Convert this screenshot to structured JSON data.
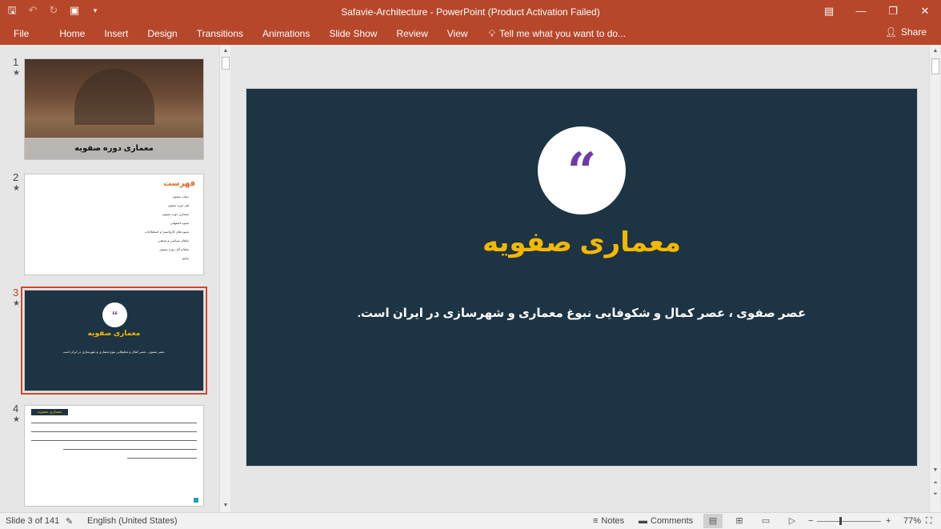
{
  "window": {
    "title": "Safavie-Architecture - PowerPoint (Product Activation Failed)",
    "qat_icons": [
      "save-icon",
      "undo-icon",
      "redo-icon",
      "present-icon",
      "customize-icon"
    ],
    "controls": [
      "ribbon-display-icon",
      "minimize-icon",
      "restore-icon",
      "close-icon"
    ]
  },
  "ribbon": {
    "tabs": [
      "File",
      "Home",
      "Insert",
      "Design",
      "Transitions",
      "Animations",
      "Slide Show",
      "Review",
      "View"
    ],
    "tell_me": "Tell me what you want to do...",
    "share": "Share"
  },
  "thumbnails": [
    {
      "num": "1",
      "title": "معماری دوره صفویه"
    },
    {
      "num": "2",
      "heading": "فهرست",
      "items": [
        "دولت صفوی",
        "هنر دوره صفوی",
        "معماری دوره صفوی",
        "شیوه اصفهانی",
        "شیوه های کاروانسرا و اصطلاحات",
        "بناهای سیاسی و مذهبی",
        "بناها و آثار دوره صفوی",
        "منابع"
      ]
    },
    {
      "num": "3",
      "title": "معماری صفویه",
      "subtitle": "عصر صفوی ، عصر کمال و شکوفایی نبوغ معماری و شهرسازی در ایران است."
    },
    {
      "num": "4",
      "heading": "معماری صفویه"
    }
  ],
  "slide": {
    "quote_mark": "“",
    "title": "معماری صفویه",
    "subtitle": "عصر صفوی ، عصر کمال و شکوفایی نبوغ معماری و شهرسازی در ایران است."
  },
  "status": {
    "slide_info": "Slide 3 of 141",
    "language": "English (United States)",
    "notes": "Notes",
    "comments": "Comments",
    "zoom": "77%"
  },
  "colors": {
    "accent": "#b7472a",
    "slide_bg": "#1d3444",
    "title_yellow": "#f5b800",
    "quote_purple": "#6f3ba8"
  }
}
